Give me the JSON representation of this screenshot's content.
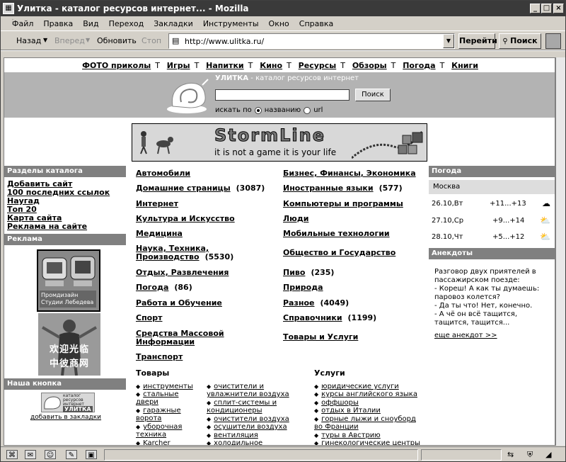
{
  "window": {
    "title": "Улитка - каталог ресурсов интернет... - Mozilla",
    "controls": [
      "_",
      "□",
      "×"
    ]
  },
  "menu": [
    "Файл",
    "Правка",
    "Вид",
    "Переход",
    "Закладки",
    "Инструменты",
    "Окно",
    "Справка"
  ],
  "nav": {
    "back": "Назад",
    "forward": "Вперед",
    "reload": "Обновить",
    "stop": "Стоп",
    "url": "http://www.ulitka.ru/",
    "go": "Перейти",
    "search": "Поиск"
  },
  "site": {
    "topnav": [
      "ФОТО приколы",
      "Игры",
      "Напитки",
      "Кино",
      "Ресурсы",
      "Обзоры",
      "Погода",
      "Книги"
    ],
    "topnav_sep": "Т",
    "brand_name": "УЛИТКА",
    "brand_tagline": " - каталог ресурсов интернет",
    "search_button": "Поиск",
    "search_by": "искать по",
    "search_opt_name": "названию",
    "search_opt_url": "url",
    "banner_title": "StormLine",
    "banner_sub": "it is not a game it is your life",
    "left": {
      "sections_head": "Разделы каталога",
      "links": [
        "Добавить сайт",
        "100 последних ссылок",
        "Наугад",
        "Топ 20",
        "Карта сайта",
        "Реклама на сайте"
      ],
      "ads_head": "Реклама",
      "ad1_caption_1": "Промдизайн",
      "ad1_caption_2": "Студии Лебедева",
      "ad2_text_1": "欢迎光临",
      "ad2_text_2": "中彼商网",
      "button_head": "Наша кнопка",
      "button_text_1": "каталог",
      "button_text_2": "ресурсов",
      "button_text_3": "интернет",
      "button_text_4": "УЛИТКА",
      "add_bookmark": "добавить в закладки"
    },
    "categories_left": [
      {
        "name": "Автомобили",
        "count": ""
      },
      {
        "name": "Домашние страницы",
        "count": "(3087)"
      },
      {
        "name": "Интернет",
        "count": ""
      },
      {
        "name": "Культура и Искусство",
        "count": ""
      },
      {
        "name": "Медицина",
        "count": ""
      },
      {
        "name": "Наука, Техника,",
        "count": ""
      },
      {
        "name": "Производство",
        "count": "(5530)"
      },
      {
        "name": "Отдых, Развлечения",
        "count": ""
      },
      {
        "name": "Погода",
        "count": "(86)"
      },
      {
        "name": "Работа и Обучение",
        "count": ""
      },
      {
        "name": "Спорт",
        "count": ""
      },
      {
        "name": "Средства Массовой",
        "count": ""
      },
      {
        "name": "Информации",
        "count": ""
      },
      {
        "name": "Транспорт",
        "count": ""
      }
    ],
    "categories_right": [
      {
        "name": "Бизнес, Финансы, Экономика",
        "count": ""
      },
      {
        "name": "Иностранные языки",
        "count": "(577)"
      },
      {
        "name": "Компьютеры и программы",
        "count": ""
      },
      {
        "name": "Люди",
        "count": ""
      },
      {
        "name": "Мобильные технологии",
        "count": ""
      },
      {
        "name": "Общество и Государство",
        "count": ""
      },
      {
        "name": "Пиво",
        "count": "(235)"
      },
      {
        "name": "Природа",
        "count": ""
      },
      {
        "name": "Разное",
        "count": "(4049)"
      },
      {
        "name": "Справочники",
        "count": "(1199)"
      },
      {
        "name": "Товары и Услуги",
        "count": ""
      }
    ],
    "goods_head": "Товары",
    "services_head": "Услуги",
    "goods_col1": [
      "инструменты",
      "стальные",
      "двери",
      "гаражные",
      "ворота",
      "уборочная",
      "техника",
      "Karcher"
    ],
    "goods_col2": [
      "очистители и",
      "увлажнители воздуха",
      "сплит-системы и",
      "кондиционеры",
      "очистители воздуха",
      "осушители воздуха",
      "вентиляция",
      "холодильное"
    ],
    "services": [
      "юридические услуги",
      "курсы английского языка",
      "оффшоры",
      "отдых в Италии",
      "горные лыжи и сноуборд",
      "во Франции",
      "туры в Австрию",
      "гинекологические центры"
    ],
    "weather_head": "Погода",
    "weather_city": "Москва",
    "weather": [
      {
        "day": "26.10,Вт",
        "temp": "+11...+13",
        "icon": "rain-cloud-icon"
      },
      {
        "day": "27.10,Ср",
        "temp": "+9...+14",
        "icon": "sun-cloud-icon"
      },
      {
        "day": "28.10,Чт",
        "temp": "+5...+12",
        "icon": "sun-cloud-icon"
      }
    ],
    "jokes_head": "Анекдоты",
    "joke_lines": [
      "Разговор двух приятелей в",
      "пассажирском поезде:",
      "- Кореш! А как ты думаешь:",
      "паровоз колется?",
      "- Да ты что! Нет, конечно.",
      "- А чё он всё тащится,",
      "тащится, тащится..."
    ],
    "more_joke": "еще анекдот >>"
  }
}
